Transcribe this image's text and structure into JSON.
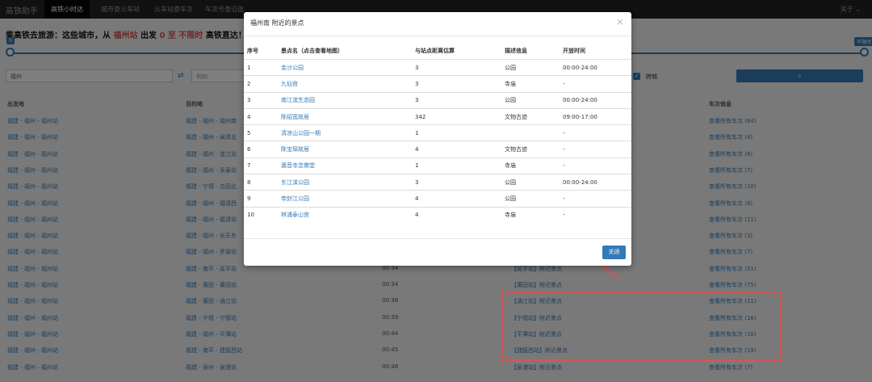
{
  "app": {
    "brand": "高铁助手",
    "right": "关于 ⌄"
  },
  "nav": [
    "高铁小时达",
    "城市查火车站",
    "火车站查车次",
    "车次号查沿途"
  ],
  "headline": {
    "prefix": "乘高铁去旅游：这些城市，从 ",
    "city": "福州站",
    "mid": " 出发 ",
    "range": "0 至 不限时",
    "suffix": " 高铁直达！ 目"
  },
  "slider": {
    "min_tag": "0",
    "max_tag": "不限时"
  },
  "filters": {
    "from_value": "福州",
    "to_placeholder": "例如",
    "cross_city_label": "跨城"
  },
  "columns": {
    "from": "出发地",
    "to": "目的地",
    "train_info": "车次信息"
  },
  "rows": [
    {
      "from": "福建 - 福州 - 福州站",
      "to": "福建 - 福州 - 福州南",
      "time": "",
      "spots": "",
      "train": "查看所有车次 (64)"
    },
    {
      "from": "福建 - 福州 - 福州站",
      "to": "福建 - 福州 - 闽清北",
      "time": "",
      "spots": "",
      "train": "查看所有车次 (8)"
    },
    {
      "from": "福建 - 福州 - 福州站",
      "to": "福建 - 福州 - 连江站",
      "time": "",
      "spots": "",
      "train": "查看所有车次 (6)"
    },
    {
      "from": "福建 - 福州 - 福州站",
      "to": "福建 - 福州 - 永泰站",
      "time": "",
      "spots": "",
      "train": "查看所有车次 (7)"
    },
    {
      "from": "福建 - 福州 - 福州站",
      "to": "福建 - 宁德 - 古田北",
      "time": "",
      "spots": "",
      "train": "查看所有车次 (10)"
    },
    {
      "from": "福建 - 福州 - 福州站",
      "to": "福建 - 福州 - 福清西",
      "time": "",
      "spots": "",
      "train": "查看所有车次 (8)"
    },
    {
      "from": "福建 - 福州 - 福州站",
      "to": "福建 - 福州 - 福清站",
      "time": "",
      "spots": "",
      "train": "查看所有车次 (11)"
    },
    {
      "from": "福建 - 福州 - 福州站",
      "to": "福建 - 福州 - 长乐东",
      "time": "",
      "spots": "",
      "train": "查看所有车次 (3)"
    },
    {
      "from": "福建 - 福州 - 福州站",
      "to": "福建 - 福州 - 罗源站",
      "time": "",
      "spots": "",
      "train": "查看所有车次 (7)"
    },
    {
      "from": "福建 - 福州 - 福州站",
      "to": "福建 - 南平 - 延平站",
      "time": "00:34",
      "spots": "【延平站】附近景点",
      "train": "查看所有车次 (51)"
    },
    {
      "from": "福建 - 福州 - 福州站",
      "to": "福建 - 莆田 - 莆田站",
      "time": "00:34",
      "spots": "【莆田站】附近景点",
      "train": "查看所有车次 (75)"
    },
    {
      "from": "福建 - 福州 - 福州站",
      "to": "福建 - 莆田 - 涵江站",
      "time": "00:36",
      "spots": "【涵江站】附近景点",
      "train": "查看所有车次 (11)"
    },
    {
      "from": "福建 - 福州 - 福州站",
      "to": "福建 - 宁德 - 宁德站",
      "time": "00:39",
      "spots": "【宁德站】附近景点",
      "train": "查看所有车次 (16)"
    },
    {
      "from": "福建 - 福州 - 福州站",
      "to": "福建 - 福州 - 平潭站",
      "time": "00:44",
      "spots": "【平潭站】附近景点",
      "train": "查看所有车次 (10)"
    },
    {
      "from": "福建 - 福州 - 福州站",
      "to": "福建 - 南平 - 建瓯西站",
      "time": "00:45",
      "spots": "【建瓯西站】附近景点",
      "train": "查看所有车次 (19)"
    },
    {
      "from": "福建 - 福州 - 福州站",
      "to": "福建 - 泉州 - 泉港站",
      "time": "00:48",
      "spots": "【泉港站】附近景点",
      "train": "查看所有车次 (7)"
    }
  ],
  "modal": {
    "title": "福州南 附近的景点",
    "close_symbol": "×",
    "close_button": "关闭",
    "headers": [
      "序号",
      "景点名（点击查看地图）",
      "与站点距离估算",
      "描述信息",
      "开放时间"
    ],
    "spots": [
      {
        "no": "1",
        "name": "金沙公园",
        "dist": "3",
        "desc": "公园",
        "hours": "00:00-24:00"
      },
      {
        "no": "2",
        "name": "九仙宫",
        "dist": "3",
        "desc": "寺庙",
        "hours": "-"
      },
      {
        "no": "3",
        "name": "南江滨生态园",
        "dist": "3",
        "desc": "公园",
        "hours": "00:00-24:00"
      },
      {
        "no": "4",
        "name": "陈绍宽故居",
        "dist": "342",
        "desc": "文物古迹",
        "hours": "09:00-17:00"
      },
      {
        "no": "5",
        "name": "清凉山公园一期",
        "dist": "1",
        "desc": "",
        "hours": "-"
      },
      {
        "no": "6",
        "name": "陈宝琛故居",
        "dist": "4",
        "desc": "文物古迹",
        "hours": "-"
      },
      {
        "no": "7",
        "name": "瀛音寺念佛堂",
        "dist": "1",
        "desc": "寺庙",
        "hours": "-"
      },
      {
        "no": "8",
        "name": "东江滨公园",
        "dist": "3",
        "desc": "公园",
        "hours": "00:00-24:00"
      },
      {
        "no": "9",
        "name": "帝封江公园",
        "dist": "4",
        "desc": "公园",
        "hours": "-"
      },
      {
        "no": "10",
        "name": "林浦泰山宫",
        "dist": "4",
        "desc": "寺庙",
        "hours": "-"
      }
    ]
  },
  "colors": {
    "accent": "#337ab7",
    "navbar": "#222222",
    "highlight": "#e84c4c",
    "emphasis": "#d9534f"
  }
}
